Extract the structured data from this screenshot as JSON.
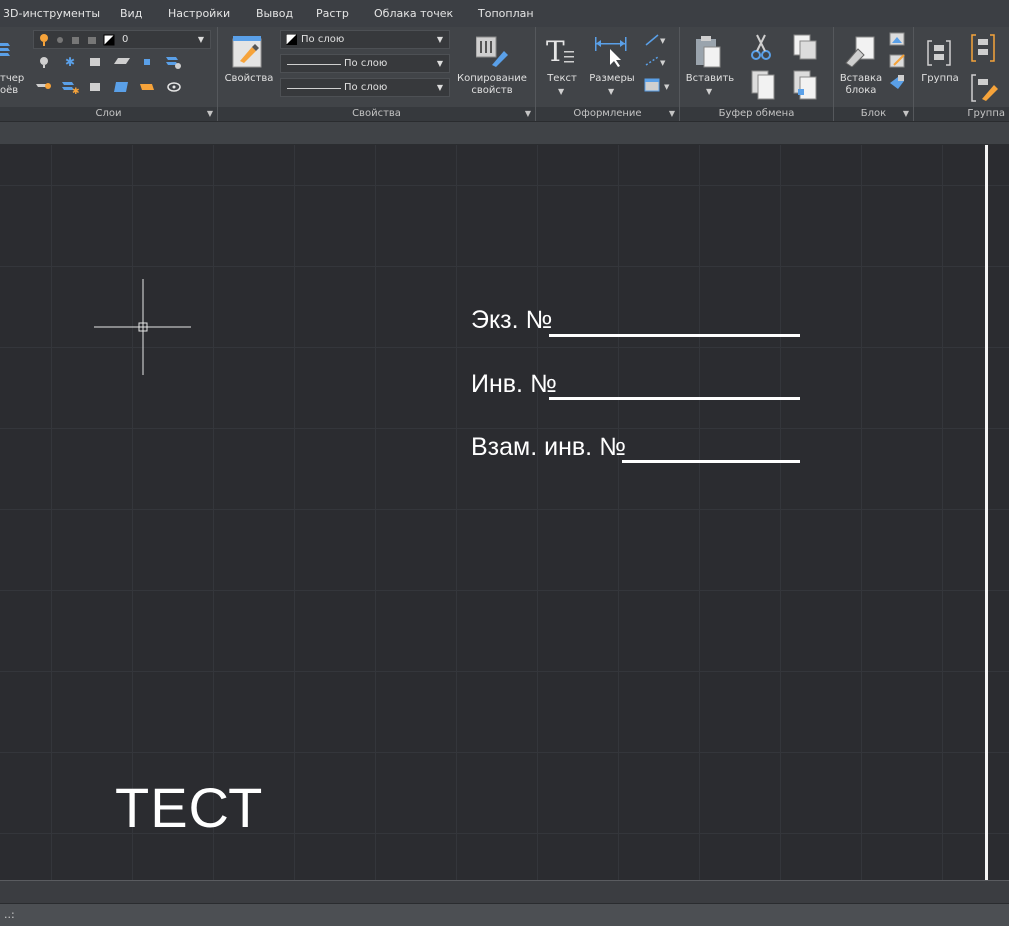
{
  "menu": [
    "3D-инструменты",
    "Вид",
    "Настройки",
    "Вывод",
    "Растр",
    "Облака точек",
    "Топоплан"
  ],
  "layers": {
    "label": "Слои",
    "dispatcher_label_line1": "тчер",
    "dispatcher_label_line2": "оёв",
    "current_layer": "0"
  },
  "properties": {
    "label": "Свойства",
    "button_label": "Свойства",
    "color_value": "По слою",
    "linetype_value": "По слою",
    "lineweight_value": "По слою",
    "copy_label_line1": "Копирование",
    "copy_label_line2": "свойств"
  },
  "annotation": {
    "label": "Оформление",
    "text_label": "Текст",
    "dims_label": "Размеры"
  },
  "clipboard": {
    "label": "Буфер обмена",
    "paste_label": "Вставить"
  },
  "block": {
    "label": "Блок",
    "insert_label_line1": "Вставка",
    "insert_label_line2": "блока"
  },
  "group": {
    "label": "Группа",
    "group_button_label": "Группа"
  },
  "drawing": {
    "field1": "Экз. №",
    "field2": "Инв. №",
    "field3": "Взам. инв. №",
    "big_text": "ТЕСТ"
  },
  "command_prompt": "..:"
}
